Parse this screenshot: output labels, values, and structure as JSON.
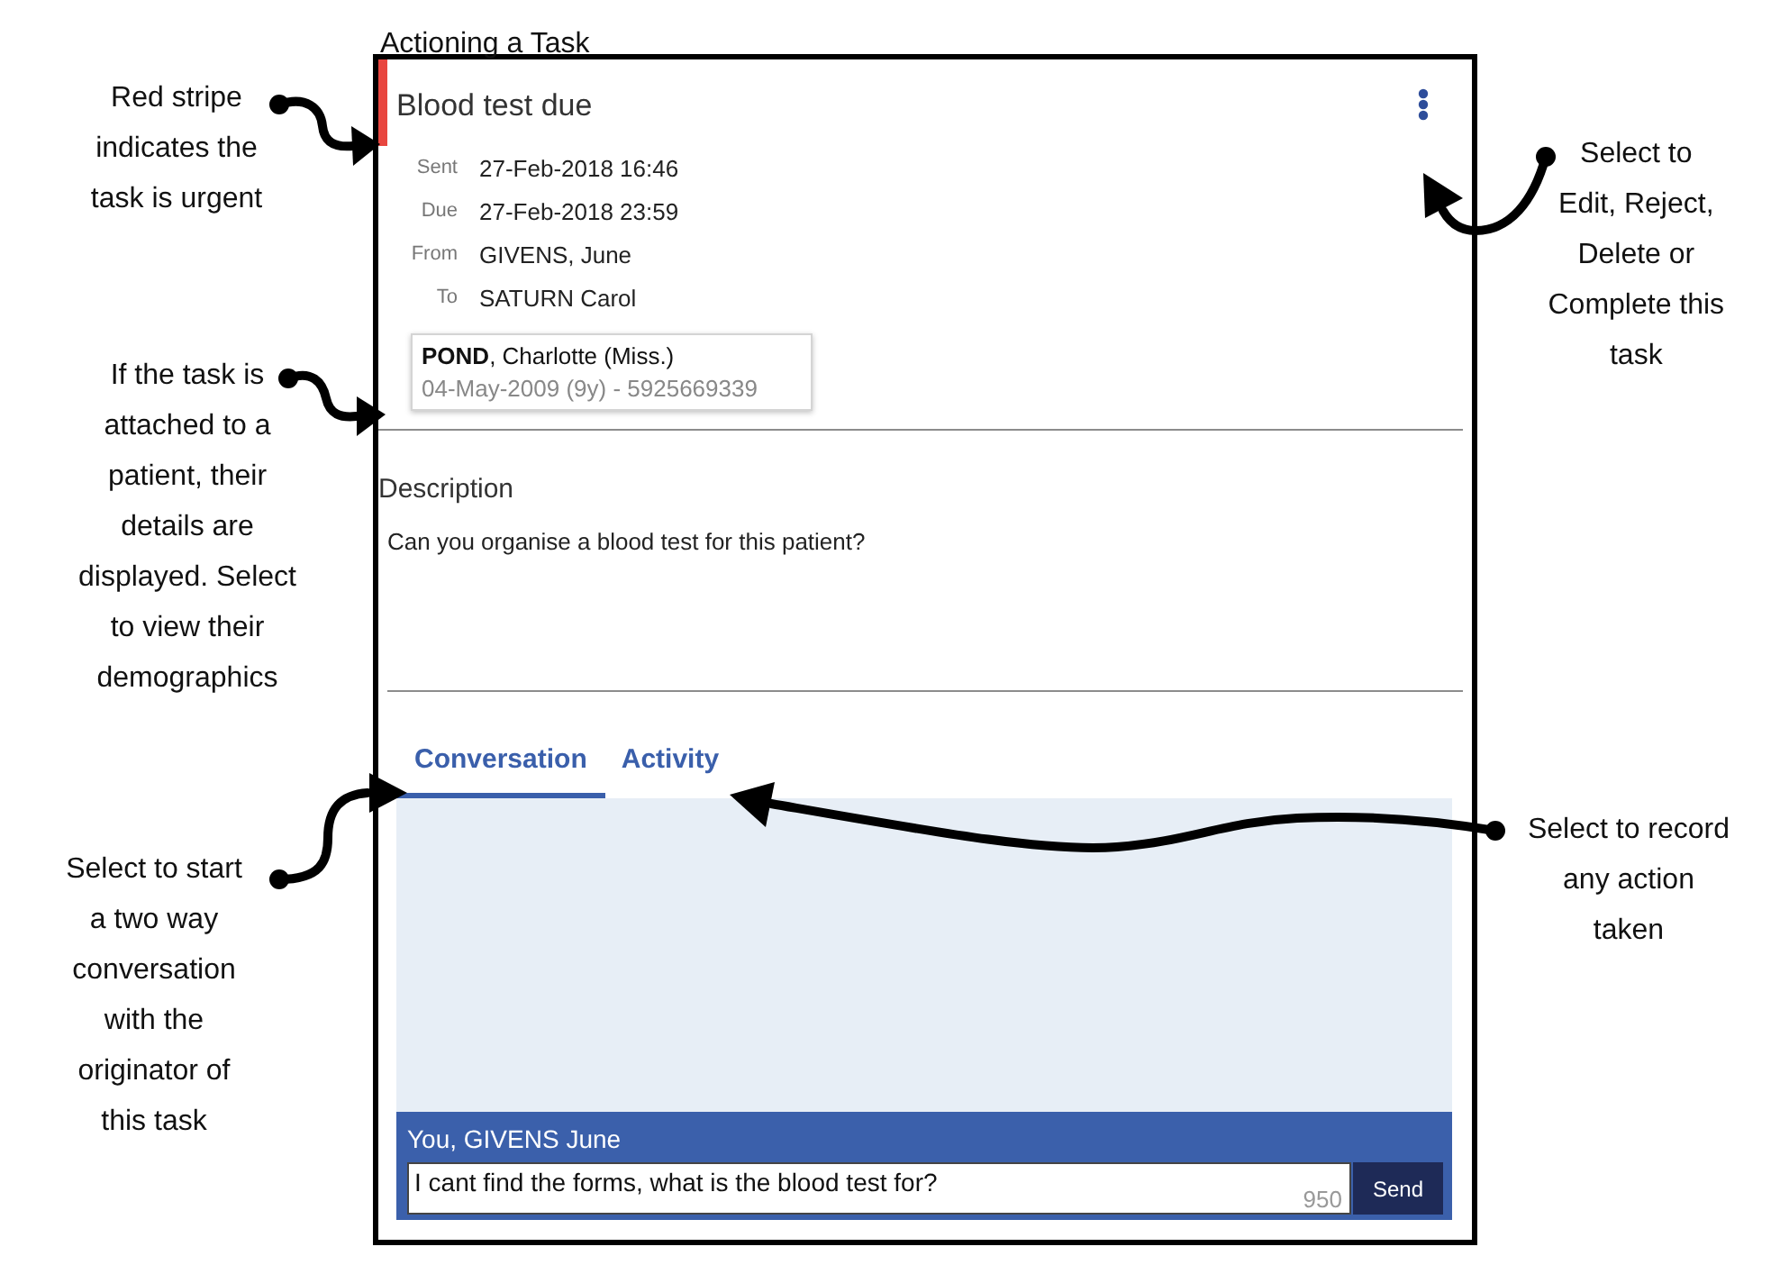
{
  "heading": "Actioning a Task",
  "task": {
    "urgent": true,
    "title": "Blood test due",
    "fields": [
      {
        "label": "Sent",
        "value": "27-Feb-2018 16:46"
      },
      {
        "label": "Due",
        "value": "27-Feb-2018 23:59"
      },
      {
        "label": "From",
        "value": "GIVENS, June"
      },
      {
        "label": "To",
        "value": "SATURN Carol"
      }
    ],
    "patient": {
      "name": "**POND**, Charlotte (Miss.)",
      "details": "04-May-2009 (9y) - 5925669339"
    },
    "description": {
      "heading": "Description",
      "text": "Can you organise a blood test for this patient?"
    },
    "tabs": [
      {
        "label": "Conversation",
        "selected": true
      },
      {
        "label": "Activity",
        "selected": false
      }
    ],
    "compose": {
      "author": "You, GIVENS June",
      "message": "I cant find the forms, what is the blood test for?",
      "remaining": "950",
      "button": "Send"
    }
  },
  "callouts": [
    {
      "text": "Red stripe indicates the task is urgent"
    },
    {
      "text": "If the task is attached to a patient, their details are displayed. Select to view their demographics"
    },
    {
      "text": "Select to start a two way conversation with the originator of this task"
    },
    {
      "text": "Select to Edit, Reject, Delete or Complete this task"
    },
    {
      "text": "Select to record any action taken"
    }
  ]
}
